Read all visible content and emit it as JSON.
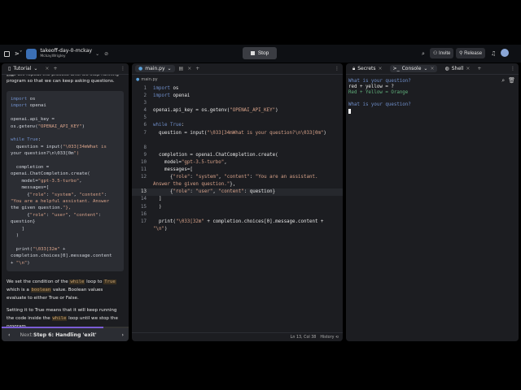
{
  "header": {
    "repl_name": "takeoff-day-0-mckay",
    "owner": "MckayWrigley",
    "stop_label": "Stop",
    "invite_label": "Invite",
    "release_label": "Release"
  },
  "tutorial": {
    "tab_label": "Tutorial",
    "intro_partial": "This will repeat the process until we stop running the",
    "intro": "program so that we can keep asking questions.",
    "code": [
      "import os",
      "import openai",
      "",
      "openai.api_key =",
      "os.getenv(\"OPENAI_API_KEY\")",
      "",
      "while True:",
      "  question = input(\"\\033[34mWhat is",
      "your question?\\n\\033[0m\")",
      "",
      "  completion =",
      "openai.ChatCompletion.create(",
      "    model=\"gpt-3.5-turbo\",",
      "    messages=[",
      "      {\"role\": \"system\", \"content\":",
      "\"You are a helpful assistant. Answer",
      "the given question.\"},",
      "      {\"role\": \"user\", \"content\":",
      "question}",
      "    ]",
      "  )",
      "",
      "  print(\"\\033[32m\" +",
      "completion.choices[0].message.content",
      "+ \"\\n\")"
    ],
    "p1_a": "We set the condition of the ",
    "p1_code1": "while",
    "p1_b": " loop to ",
    "p1_code2": "True",
    "p1_c": " which is a ",
    "p1_code3": "boolean",
    "p1_d": " value. Boolean values evaluate to either True or False.",
    "p2_a": "Setting it to True means that it will keep running the code inside the ",
    "p2_code": "while",
    "p2_b": " loop until we stop the program.",
    "next_prefix": "Next: ",
    "next_label": "Step 6: Handling 'exit'",
    "progress": 0.8
  },
  "editor": {
    "tab_label": "main.py",
    "breadcrumb": "main.py",
    "active_line": 13,
    "lines": [
      "import os",
      "import openai",
      "",
      "openai.api_key = os.getenv(\"OPENAI_API_KEY\")",
      "",
      "while True:",
      "  question = input(\"\\033[34mWhat is your question?\\n\\033[0m\")",
      "",
      "  completion = openai.ChatCompletion.create(",
      "    model=\"gpt-3.5-turbo\",",
      "    messages=[",
      "      {\"role\": \"system\", \"content\": \"You are an assistant. Answer the given question.\"},",
      "      {\"role\": \"user\", \"content\": question}",
      "  ]",
      "  )",
      "",
      "  print(\"\\033[32m\" + completion.choices[0].message.content + \"\\n\")"
    ],
    "status": "Ln 13, Col 38",
    "history_label": "History"
  },
  "console": {
    "tabs": [
      "Secrets",
      "Console",
      "Shell"
    ],
    "output": [
      {
        "text": "What is your question?",
        "color": "#6f8ec9"
      },
      {
        "text": "red + yellow = ?",
        "color": "#e6e6e6"
      },
      {
        "text": "Red + Yellow = Orange",
        "color": "#5fae7a"
      },
      {
        "text": "",
        "color": "#e6e6e6"
      },
      {
        "text": "What is your question?",
        "color": "#6f8ec9"
      }
    ]
  }
}
